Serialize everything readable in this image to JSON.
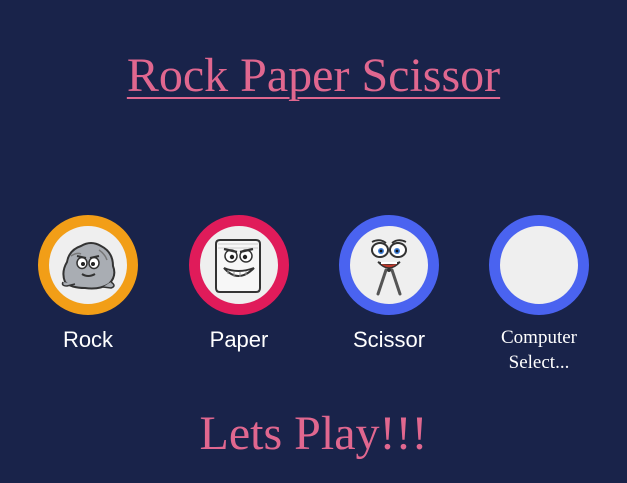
{
  "title": "Rock Paper Scissor",
  "choices": [
    {
      "label": "Rock",
      "icon": "rock-face-icon",
      "color": "#f29e17"
    },
    {
      "label": "Paper",
      "icon": "paper-face-icon",
      "color": "#e01b5a"
    },
    {
      "label": "Scissor",
      "icon": "scissor-face-icon",
      "color": "#4a63f0"
    }
  ],
  "computer": {
    "label": "Computer Select...",
    "color": "#4a63f0"
  },
  "status": "Lets Play!!!",
  "colors": {
    "background": "#19234a",
    "accent": "#e0678f",
    "ring_inner": "#efefef"
  }
}
